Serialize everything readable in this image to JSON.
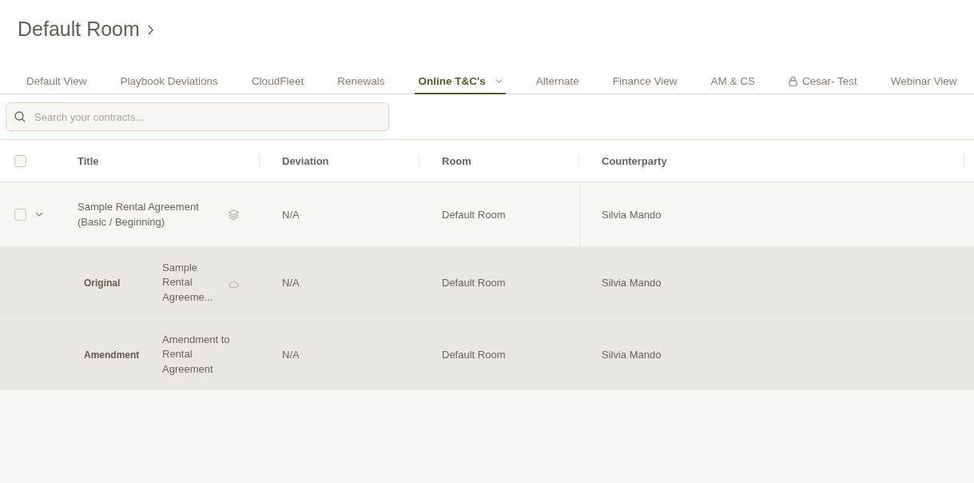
{
  "page": {
    "title": "Default Room"
  },
  "tabs": [
    {
      "label": "Default View",
      "selected": false,
      "locked": false
    },
    {
      "label": "Playbook Deviations",
      "selected": false,
      "locked": false
    },
    {
      "label": "CloudFleet",
      "selected": false,
      "locked": false
    },
    {
      "label": "Renewals",
      "selected": false,
      "locked": false
    },
    {
      "label": "Online T&C's",
      "selected": true,
      "locked": false
    },
    {
      "label": "Alternate",
      "selected": false,
      "locked": false
    },
    {
      "label": "Finance View",
      "selected": false,
      "locked": false
    },
    {
      "label": "AM & CS",
      "selected": false,
      "locked": false
    },
    {
      "label": "Cesar- Test",
      "selected": false,
      "locked": true
    },
    {
      "label": "Webinar View",
      "selected": false,
      "locked": false
    }
  ],
  "search": {
    "placeholder": "Search your contracts..."
  },
  "table": {
    "select_all": {
      "checked": false
    },
    "columns": [
      "Title",
      "Deviation",
      "Room",
      "Counterparty"
    ],
    "rows": [
      {
        "title": "Sample Rental Agreement (Basic / Beginning)",
        "deviation": "N/A",
        "room": "Default Room",
        "counterparty": "Silvia Mando",
        "checked": false,
        "expanded": true,
        "children": [
          {
            "relation": "Original",
            "title": "Sample Rental Agreeme...",
            "synced": true,
            "deviation": "N/A",
            "room": "Default Room",
            "counterparty": "Silvia Mando"
          },
          {
            "relation": "Amendment",
            "title": "Amendment to Rental Agreement",
            "synced": false,
            "deviation": "N/A",
            "room": "Default Room",
            "counterparty": "Silvia Mando"
          }
        ]
      }
    ]
  }
}
